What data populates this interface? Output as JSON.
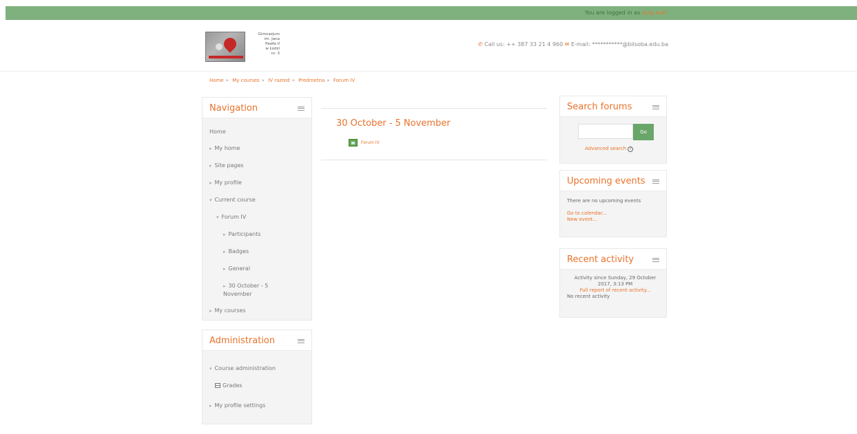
{
  "topbar": {
    "login_prefix": "You are logged in as",
    "login_user": "(Log out)"
  },
  "header": {
    "school_name": "Gimnazjum\nim. Jana\nPawła II\nw Łodzi\nnr. 3",
    "phone_icon": "phone-icon",
    "phone": "Call us: ++ 387 33 21 4 960",
    "email_icon": "envelope-icon",
    "email": "E-mail: ***********@bilsoba.edu.ba"
  },
  "breadcrumb": [
    "Home",
    "My courses",
    "IV razred",
    "Predmetna",
    "Forum IV"
  ],
  "navigation": {
    "title": "Navigation",
    "items": [
      {
        "label": "Home",
        "level": 1,
        "arrow": ""
      },
      {
        "label": "My home",
        "level": 1,
        "arrow": "▸"
      },
      {
        "label": "Site pages",
        "level": 1,
        "arrow": "▸"
      },
      {
        "label": "My profile",
        "level": 1,
        "arrow": "▸"
      },
      {
        "label": "Current course",
        "level": 1,
        "arrow": "▾"
      },
      {
        "label": "Forum IV",
        "level": 2,
        "arrow": "▾"
      },
      {
        "label": "Participants",
        "level": 3,
        "arrow": "▸"
      },
      {
        "label": "Badges",
        "level": 3,
        "arrow": "▸"
      },
      {
        "label": "General",
        "level": 3,
        "arrow": "▸"
      },
      {
        "label": "30 October - 5 November",
        "level": 3,
        "arrow": "▸"
      },
      {
        "label": "My courses",
        "level": 1,
        "arrow": "▸"
      }
    ]
  },
  "administration": {
    "title": "Administration",
    "course_admin": "Course administration",
    "grades": "Grades",
    "profile_settings": "My profile settings"
  },
  "main": {
    "section_title": "30 October - 5 November",
    "activity_label": "Forum IV"
  },
  "search_forums": {
    "title": "Search forums",
    "input_value": "",
    "go_label": "Go",
    "advanced": "Advanced search"
  },
  "upcoming": {
    "title": "Upcoming events",
    "empty": "There are no upcoming events",
    "goto_calendar": "Go to calendar...",
    "new_event": "New event..."
  },
  "recent": {
    "title": "Recent activity",
    "since": "Activity since Sunday, 29 October 2017, 3:13 PM",
    "full_report": "Full report of recent activity...",
    "none": "No recent activity"
  },
  "colors": {
    "accent": "#e8722a",
    "topbar": "#7fb17f",
    "go_button": "#6aa56a"
  }
}
